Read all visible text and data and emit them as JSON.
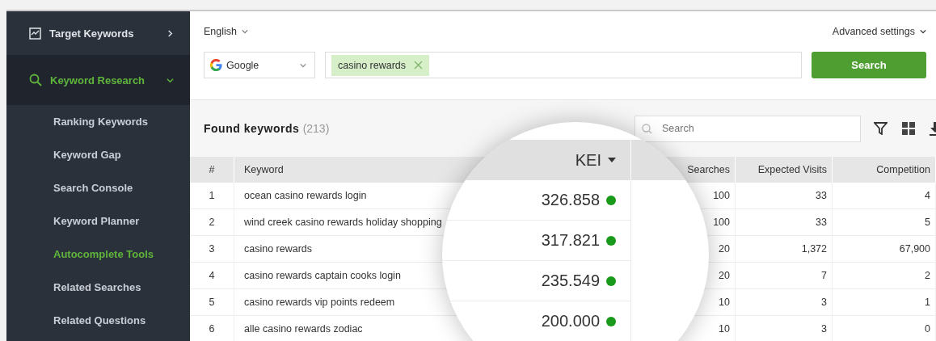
{
  "sidebar": {
    "sections": [
      {
        "label": "Target Keywords",
        "expanded": false,
        "selected": false
      },
      {
        "label": "Keyword Research",
        "expanded": true,
        "selected": true,
        "children": [
          {
            "label": "Ranking Keywords",
            "selected": false
          },
          {
            "label": "Keyword Gap",
            "selected": false
          },
          {
            "label": "Search Console",
            "selected": false
          },
          {
            "label": "Keyword Planner",
            "selected": false
          },
          {
            "label": "Autocomplete Tools",
            "selected": true
          },
          {
            "label": "Related Searches",
            "selected": false
          },
          {
            "label": "Related Questions",
            "selected": false
          }
        ]
      }
    ]
  },
  "query": {
    "language": "English",
    "advanced": "Advanced settings",
    "engine": "Google",
    "tags": [
      "casino rewards"
    ],
    "button": "Search"
  },
  "results": {
    "title": "Found keywords",
    "count": "(213)",
    "search_placeholder": "Search",
    "table": {
      "columns": [
        "#",
        "Keyword",
        "Searches",
        "Expected Visits",
        "Competition"
      ],
      "rows": [
        [
          "1",
          "ocean casino rewards login",
          "100",
          "33",
          "4"
        ],
        [
          "2",
          "wind creek casino rewards holiday shopping",
          "100",
          "33",
          "5"
        ],
        [
          "3",
          "casino rewards",
          "20",
          "1,372",
          "67,900"
        ],
        [
          "4",
          "casino rewards captain cooks login",
          "20",
          "7",
          "2"
        ],
        [
          "5",
          "casino rewards vip points redeem",
          "10",
          "3",
          "1"
        ],
        [
          "6",
          "alle casino rewards zodiac",
          "10",
          "3",
          "0"
        ]
      ]
    },
    "magnifier": {
      "column": "KEI",
      "values": [
        "326.858",
        "317.821",
        "235.549",
        "200.000"
      ]
    }
  }
}
